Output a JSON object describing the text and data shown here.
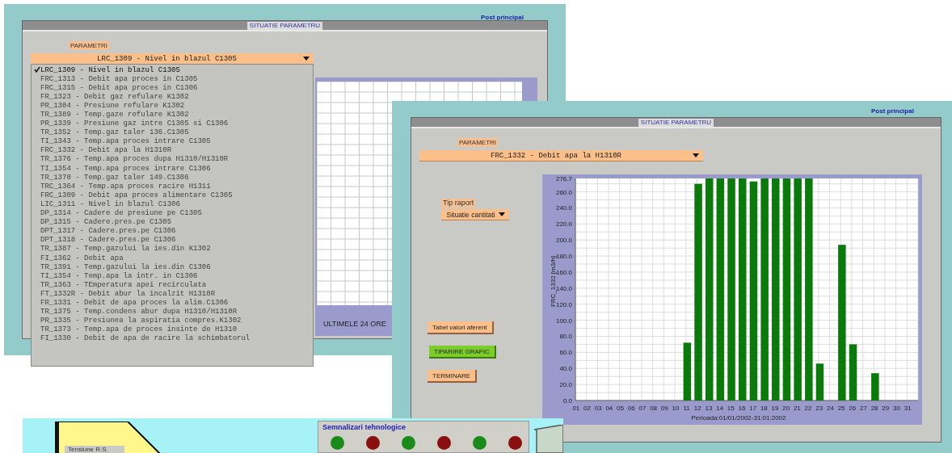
{
  "screens": [
    {
      "kind": "list-window",
      "title": "SITUATIE PARAMETRU",
      "corner_label": "Post principal",
      "parameter_label": "PARAMETRI",
      "parameter_value": "LRC_1309 - Nivel in blazul C1305",
      "chart_caption": "ULTIMELE 24 ORE",
      "options": [
        {
          "label": "LRC_1309 - Nivel in blazul C1305",
          "selected": true
        },
        {
          "label": "FRC_1313 - Debit apa proces in C1305",
          "selected": false
        },
        {
          "label": "FRC_1315 - Debit apa proces in C1306",
          "selected": false
        },
        {
          "label": "FR_1323 - Debit gaz refulare K1302",
          "selected": false
        },
        {
          "label": "PR_1304 - Presiune refulare K1302",
          "selected": false
        },
        {
          "label": "TR_1389 - Temp.gaze refulare K1302",
          "selected": false
        },
        {
          "label": "PR_1339 - Presiune gaz intre C1305 si C1306",
          "selected": false
        },
        {
          "label": "TR_1352 - Temp.gaz taler 136.C1305",
          "selected": false
        },
        {
          "label": "TI_1343 - Temp.apa proces intrare C1305",
          "selected": false
        },
        {
          "label": "FRC_1332 - Debit apa la H1310R",
          "selected": false
        },
        {
          "label": "TR_1376 - Temp.apa proces dupa H1310/H1310R",
          "selected": false
        },
        {
          "label": "TI_1354 - Temp.apa proces intrare C1306",
          "selected": false
        },
        {
          "label": "TR_1370 - Temp.gaz taler 149.C1306",
          "selected": false
        },
        {
          "label": "TRC_1364 - Temp.apa proces racire H1311",
          "selected": false
        },
        {
          "label": "FRC_1309 - Debit apa proces alimentare C1305",
          "selected": false
        },
        {
          "label": "LIC_1311 - Nivel in blazul C1306",
          "selected": false
        },
        {
          "label": "DP_1314 - Cadere de presiune pe C1305",
          "selected": false
        },
        {
          "label": "DP_1315 - Cadere.pres.pe C1305",
          "selected": false
        },
        {
          "label": "DPT_1317 - Cadere.pres.pe C1306",
          "selected": false
        },
        {
          "label": "DPT_1318 - Cadere.pres.pe C1306",
          "selected": false
        },
        {
          "label": "TR_1387 - Temp.gazului la ies.din K1302",
          "selected": false
        },
        {
          "label": "FI_1362 - Debit apa",
          "selected": false
        },
        {
          "label": "TR_1391 - Temp.gazului la ies.din C1306",
          "selected": false
        },
        {
          "label": "TI_1354 - Temp.apa la intr. in C1306",
          "selected": false
        },
        {
          "label": "TR_1363 - TEmperatura apei recirculata",
          "selected": false
        },
        {
          "label": "FT_1332R - Debit abur la incalzit H1310R",
          "selected": false
        },
        {
          "label": "FR_1331 - Debit de apa proces la alim.C1306",
          "selected": false
        },
        {
          "label": "TR_1375 - Temp.condens abur dupa H1310/H1310R",
          "selected": false
        },
        {
          "label": "PR_1335 - Presiunea la aspiratia compres.K1302",
          "selected": false
        },
        {
          "label": "TR_1373 - Temp.apa de proces insinte de H1310",
          "selected": false
        },
        {
          "label": "FI_1330 - Debit de apa de racire la schimbatorul",
          "selected": false
        }
      ]
    },
    {
      "kind": "chart-window",
      "title": "SITUATIE PARAMETRU",
      "corner_label": "Post principal",
      "parameter_label": "PARAMETRI",
      "parameter_value": "FRC_1332 - Debit apa la H1310R",
      "report_label": "Tip raport",
      "report_value": "Situatie cantitati",
      "buttons": [
        {
          "label": "Tabel valori aferent",
          "kind": "normal"
        },
        {
          "label": "TIPARIRE GRAFIC",
          "kind": "print"
        },
        {
          "label": "TERMINARE",
          "kind": "normal"
        }
      ],
      "chart_data": {
        "type": "bar",
        "xlabel": "Perioada:01/01/2002-31:01:2002",
        "ylabel": "FRC_1332 [m3/h]",
        "categories": [
          "01",
          "02",
          "03",
          "04",
          "05",
          "06",
          "07",
          "08",
          "09",
          "10",
          "11",
          "12",
          "13",
          "14",
          "15",
          "16",
          "17",
          "18",
          "19",
          "20",
          "21",
          "22",
          "23",
          "24",
          "25",
          "26",
          "27",
          "28",
          "29",
          "30",
          "31"
        ],
        "grid": true,
        "series": [
          {
            "color": "#0a7a0a",
            "values": [
              0,
              0,
              0,
              0,
              0,
              0,
              0,
              0,
              0,
              0,
              72,
              270,
              276.7,
              276.7,
              276.7,
              276.7,
              273,
              276.7,
              276.7,
              276.7,
              276.7,
              276.7,
              46,
              0,
              194,
              70,
              0,
              34,
              0,
              0,
              0
            ]
          }
        ],
        "ylim": [
          0,
          276.7
        ],
        "yticks": [
          {
            "value": 0,
            "label": "0.0"
          },
          {
            "value": 20,
            "label": "20.0"
          },
          {
            "value": 40,
            "label": "40.0"
          },
          {
            "value": 60,
            "label": "60.0"
          },
          {
            "value": 80,
            "label": "80.0"
          },
          {
            "value": 100,
            "label": "100.0"
          },
          {
            "value": 120,
            "label": "120.0"
          },
          {
            "value": 140,
            "label": "140.0"
          },
          {
            "value": 160,
            "label": "160.0"
          },
          {
            "value": 180,
            "label": "180.0"
          },
          {
            "value": 200,
            "label": "200.0"
          },
          {
            "value": 220,
            "label": "220.0"
          },
          {
            "value": 240,
            "label": "240.0"
          },
          {
            "value": 260,
            "label": "260.0"
          },
          {
            "value": 276.7,
            "label": "276.7"
          }
        ]
      }
    },
    {
      "kind": "panel-screen",
      "gauge_label": "Tensiune R.S.",
      "signals": {
        "title": "Semnalizari tehnologice",
        "lights": [
          {
            "color": "#1a8a1a"
          },
          {
            "color": "#8a1010"
          },
          {
            "color": "#1a8a1a"
          },
          {
            "color": "#8a1010"
          },
          {
            "color": "#1a8a1a"
          },
          {
            "color": "#8a1010"
          }
        ]
      }
    }
  ]
}
